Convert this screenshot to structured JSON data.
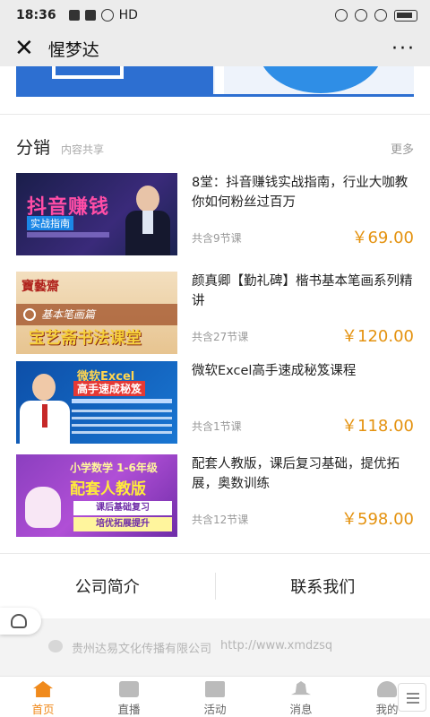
{
  "status_bar": {
    "time": "18:36",
    "network": "HD"
  },
  "nav": {
    "title": "惺梦达",
    "more": "···"
  },
  "section": {
    "title": "分销",
    "subtitle": "内容共享",
    "more": "更多"
  },
  "courses": [
    {
      "title": "8堂：抖音赚钱实战指南，行业大咖教你如何粉丝过百万",
      "count": "共含9节课",
      "price": "￥69.00",
      "thumb": {
        "main": "抖音赚钱",
        "sub": "实战指南"
      }
    },
    {
      "title": "颜真卿【勤礼碑】楷书基本笔画系列精讲",
      "count": "共含27节课",
      "price": "￥120.00",
      "thumb": {
        "seal": "寶藝齋",
        "band": "基本笔画篇",
        "main": "宝艺斋书法课堂"
      }
    },
    {
      "title": "微软Excel高手速成秘笈课程",
      "count": "共含1节课",
      "price": "￥118.00",
      "thumb": {
        "l1": "微软Excel",
        "l2": "高手速成秘笈"
      }
    },
    {
      "title": "配套人教版，课后复习基础，提优拓展，奥数训练",
      "count": "共含12节课",
      "price": "￥598.00",
      "thumb": {
        "l1": "小学数学 1-6年级",
        "l2a": "配套",
        "l2b": "人教版",
        "l3": "课后基础复习",
        "l4": "培优拓展提升"
      }
    }
  ],
  "company": {
    "intro": "公司简介",
    "contact": "联系我们"
  },
  "footer": {
    "company_name": "贵州达易文化传播有限公司",
    "url": "http://www.xmdzsq"
  },
  "tabs": [
    {
      "label": "首页",
      "icon": "home-icon"
    },
    {
      "label": "直播",
      "icon": "video-icon"
    },
    {
      "label": "活动",
      "icon": "gift-icon"
    },
    {
      "label": "消息",
      "icon": "bell-icon"
    },
    {
      "label": "我的",
      "icon": "user-icon"
    }
  ],
  "colors": {
    "accent": "#f08a1c",
    "price": "#e4920f"
  }
}
